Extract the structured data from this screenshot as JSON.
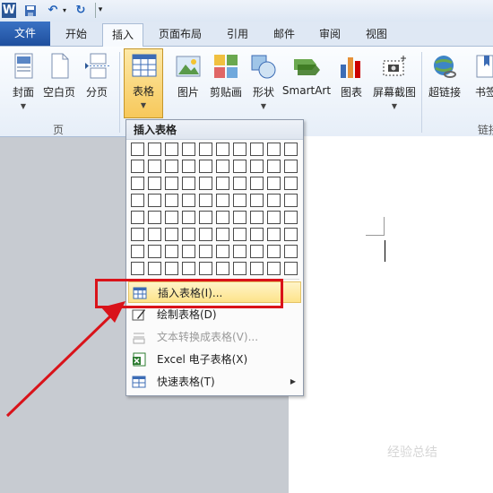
{
  "window": {
    "app_icon": "W",
    "quick_access": [
      "save-icon",
      "undo-icon",
      "redo-icon",
      "customize-icon"
    ]
  },
  "tabs": [
    "文件",
    "开始",
    "插入",
    "页面布局",
    "引用",
    "邮件",
    "审阅",
    "视图"
  ],
  "active_tab": "插入",
  "ribbon": {
    "buttons": [
      {
        "label": "封面",
        "icon": "cover-page-icon",
        "dropdown": true
      },
      {
        "label": "空白页",
        "icon": "blank-page-icon",
        "dropdown": false
      },
      {
        "label": "分页",
        "icon": "page-break-icon",
        "dropdown": false
      },
      {
        "label": "表格",
        "icon": "table-icon",
        "dropdown": true,
        "pressed": true
      },
      {
        "label": "图片",
        "icon": "picture-icon",
        "dropdown": false
      },
      {
        "label": "剪贴画",
        "icon": "clipart-icon",
        "dropdown": false
      },
      {
        "label": "形状",
        "icon": "shapes-icon",
        "dropdown": true
      },
      {
        "label": "SmartArt",
        "icon": "smartart-icon",
        "dropdown": false
      },
      {
        "label": "图表",
        "icon": "chart-icon",
        "dropdown": false
      },
      {
        "label": "屏幕截图",
        "icon": "screenshot-icon",
        "dropdown": true
      },
      {
        "label": "超链接",
        "icon": "hyperlink-icon",
        "dropdown": false
      },
      {
        "label": "书签",
        "icon": "bookmark-icon",
        "dropdown": false
      }
    ],
    "groups": [
      "页",
      "链接"
    ]
  },
  "menu": {
    "header": "插入表格",
    "grid_cols": 10,
    "grid_rows": 8,
    "items": [
      {
        "label": "插入表格(I)...",
        "icon": "insert-table-icon",
        "disabled": false,
        "highlighted": true
      },
      {
        "label": "绘制表格(D)",
        "icon": "draw-table-icon",
        "disabled": false
      },
      {
        "label": "文本转换成表格(V)...",
        "icon": "text-to-table-icon",
        "disabled": true
      },
      {
        "label": "Excel 电子表格(X)",
        "icon": "excel-icon",
        "disabled": false
      },
      {
        "label": "快速表格(T)",
        "icon": "quick-table-icon",
        "disabled": false,
        "submenu": true
      }
    ]
  },
  "watermark": "经验总结"
}
